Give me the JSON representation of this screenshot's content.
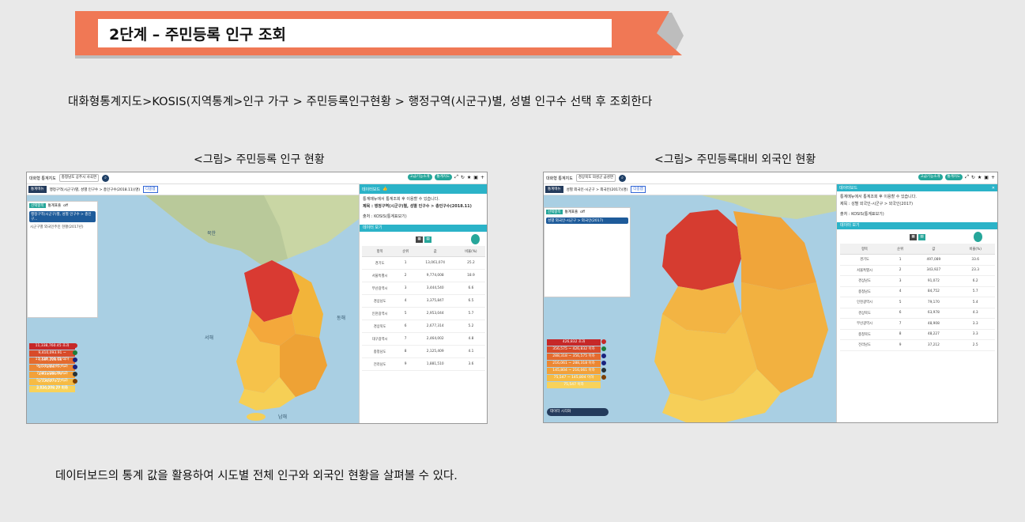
{
  "header": {
    "title": "2단계 – 주민등록 인구 조회"
  },
  "path_text": "대화형통계지도>KOSIS(지역통계>인구 가구 > 주민등록인구현황 > 행정구역(시군구)별, 성별 인구수 선택 후 조회한다",
  "captions": {
    "left": "<그림> 주민등록 인구 현황",
    "right": "<그림> 주민등록대비 외국인 현황"
  },
  "summary": "데이터보드의 통계 값을 활용하여 시도별 전체 인구와 외국인 현황을 살펴볼 수 있다.",
  "colors": {
    "banner": "#f07855",
    "teal": "#2bb3c8",
    "navy": "#243b5c",
    "sea": "#a9cfe3"
  },
  "shot1": {
    "app_title": "대화형 통계지도",
    "region_select": "충청남도 공주시 사곡면",
    "btn_extra": "고급기능소개",
    "btn_stat": "통계지도",
    "menu": "통계메뉴",
    "crumb": "행정구역(시군구)별, 성별 인구수 > 총인구수(2018.11)(명)",
    "action_btn": "다중맵",
    "left_chip": "선택항목",
    "left_label": "통계표출",
    "left_off": "off",
    "left_item": "행정구역(시군구)별, 성별 인구수 > 총인구...",
    "left_sub": "시군구별 외국인주민 현황(2017년)",
    "panel_title": "데이터보드",
    "panel_line1": "통계메뉴에서 통계조회 후 이용할 수 있습니다.",
    "panel_line2": "제목 : 행정구역(시군구)별, 성별 인구수 > 총인구수(2018.11)",
    "panel_line3": "출처 : KOSIS(통계표보기)",
    "data_view": "데이터 보기",
    "map_labels": {
      "north": "북한",
      "east": "동해",
      "west": "서해",
      "south": "남해"
    },
    "legend": [
      "11,338,760.45 초과",
      "9,410,093.91 ~ 11,338,760.45 이하",
      "7,587,228.38 ~ 9,410,093.91 이하",
      "5,773,647.77 ~ 7,587,228.38 이하",
      "3,934,000.79 ~ 5,773,647.77 이하",
      "2,120,274.27 ~ 3,934,000.79 이하",
      "2,120,274.27 이하"
    ],
    "table": {
      "headers": [
        "항목",
        "순위",
        "값",
        "비율(%)"
      ],
      "rows": [
        [
          "경기도",
          "1",
          "13,061,074",
          "25.2"
        ],
        [
          "서울특별시",
          "2",
          "9,774,008",
          "18.9"
        ],
        [
          "부산광역시",
          "3",
          "3,444,540",
          "6.6"
        ],
        [
          "경상남도",
          "4",
          "3,375,847",
          "6.5"
        ],
        [
          "인천광역시",
          "5",
          "2,953,044",
          "5.7"
        ],
        [
          "경상북도",
          "6",
          "2,677,314",
          "5.2"
        ],
        [
          "대구광역시",
          "7",
          "2,464,002",
          "4.8"
        ],
        [
          "충청남도",
          "8",
          "2,125,409",
          "4.1"
        ],
        [
          "전라남도",
          "9",
          "1,881,510",
          "3.6"
        ]
      ]
    }
  },
  "shot2": {
    "app_title": "대화형 통계지도",
    "region_select": "경상북도 의성군 금성면",
    "btn_extra": "고급기능소개",
    "btn_stat": "통계지도",
    "menu": "통계메뉴",
    "crumb": "성별 외국인-시군구 > 외국인(2017)(명)",
    "action_btn": "다중맵",
    "left_label": "통계표출",
    "left_off": "off",
    "left_chip": "선택항목",
    "left_item": "성별 외국인-시군구 > 외국인(2017)",
    "panel_title": "데이터보드",
    "panel_line1": "통계메뉴에서 통계조회 후 이용할 수 있습니다.",
    "panel_line2": "제목 : 성별 외국인-시군구 > 외국인(2017)",
    "panel_line3": "출처 : KOSIS(통계표보기)",
    "data_view": "데이터 보기",
    "board_btn": "데이터 시각화",
    "legend": [
      "426,832 초과",
      "356,575 ~ 426,832 이하",
      "288,318 ~ 356,575 이하",
      "216,061 ~ 288,318 이하",
      "145,804 ~ 216,061 이하",
      "75,547 ~ 145,804 이하",
      "75,547 이하"
    ],
    "table": {
      "headers": [
        "항목",
        "순위",
        "값",
        "비율(%)"
      ],
      "rows": [
        [
          "경기도",
          "1",
          "497,089",
          "33.6"
        ],
        [
          "서울특별시",
          "2",
          "343,927",
          "23.3"
        ],
        [
          "경상남도",
          "3",
          "91,072",
          "6.2"
        ],
        [
          "충청남도",
          "4",
          "84,752",
          "5.7"
        ],
        [
          "인천광역시",
          "5",
          "79,170",
          "5.4"
        ],
        [
          "경상북도",
          "6",
          "63,978",
          "4.3"
        ],
        [
          "부산광역시",
          "7",
          "48,908",
          "3.3"
        ],
        [
          "충청북도",
          "8",
          "48,227",
          "3.3"
        ],
        [
          "전라남도",
          "9",
          "37,212",
          "2.5"
        ]
      ]
    }
  }
}
